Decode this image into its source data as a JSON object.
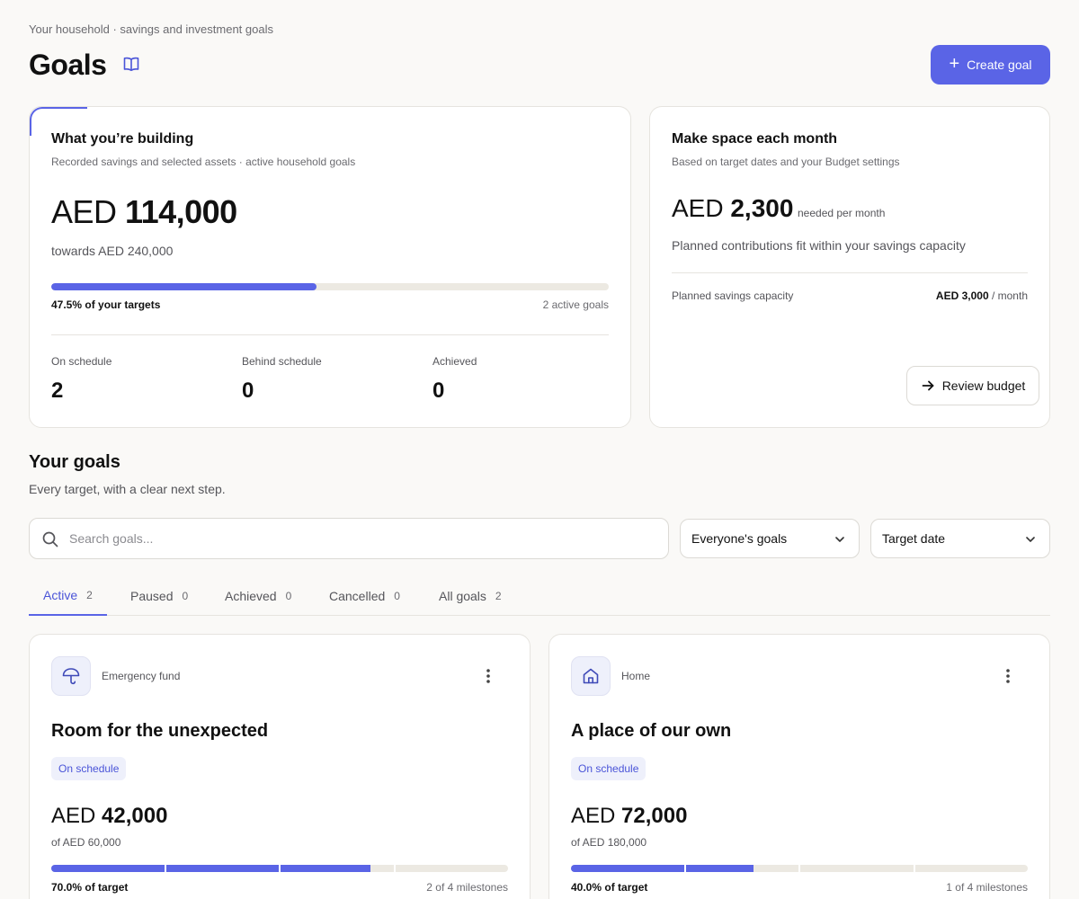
{
  "header": {
    "context": "Your household · savings and investment goals",
    "title": "Goals",
    "create_label": "Create goal"
  },
  "building": {
    "title": "What you’re building",
    "subtitle": "Recorded savings and selected assets · active household goals",
    "currency": "AED",
    "amount": "114,000",
    "towards": "towards AED 240,000",
    "progress_fraction": 0.475,
    "progress_label": "47.5% of your targets",
    "active_goals": "2 active goals",
    "stats": [
      {
        "label": "On schedule",
        "value": "2"
      },
      {
        "label": "Behind schedule",
        "value": "0"
      },
      {
        "label": "Achieved",
        "value": "0"
      }
    ]
  },
  "monthly": {
    "title": "Make space each month",
    "subtitle": "Based on target dates and your Budget settings",
    "currency": "AED",
    "amount": "2,300",
    "suffix": "needed per month",
    "note": "Planned contributions fit within your savings capacity",
    "capacity_label": "Planned savings capacity",
    "capacity_value": "AED 3,000",
    "capacity_unit": "/ month",
    "review_label": "Review budget"
  },
  "goals_section": {
    "title": "Your goals",
    "subtitle": "Every target, with a clear next step.",
    "search_placeholder": "Search goals...",
    "owner_filter": "Everyone's goals",
    "sort": "Target date"
  },
  "tabs": [
    {
      "label": "Active",
      "count": "2"
    },
    {
      "label": "Paused",
      "count": "0"
    },
    {
      "label": "Achieved",
      "count": "0"
    },
    {
      "label": "Cancelled",
      "count": "0"
    },
    {
      "label": "All goals",
      "count": "2"
    }
  ],
  "goals": [
    {
      "category": "Emergency fund",
      "icon": "umbrella-icon",
      "name": "Room for the unexpected",
      "status": "On schedule",
      "currency": "AED",
      "amount": "42,000",
      "target": "of AED 60,000",
      "progress_fraction": 0.7,
      "pct_label": "70.0% of target",
      "milestones_label": "2 of 4 milestones"
    },
    {
      "category": "Home",
      "icon": "home-icon",
      "name": "A place of our own",
      "status": "On schedule",
      "currency": "AED",
      "amount": "72,000",
      "target": "of AED 180,000",
      "progress_fraction": 0.4,
      "pct_label": "40.0% of target",
      "milestones_label": "1 of 4 milestones"
    }
  ],
  "colors": {
    "accent": "#5a64e6",
    "track": "#ece9e2",
    "background": "#faf9f7"
  }
}
